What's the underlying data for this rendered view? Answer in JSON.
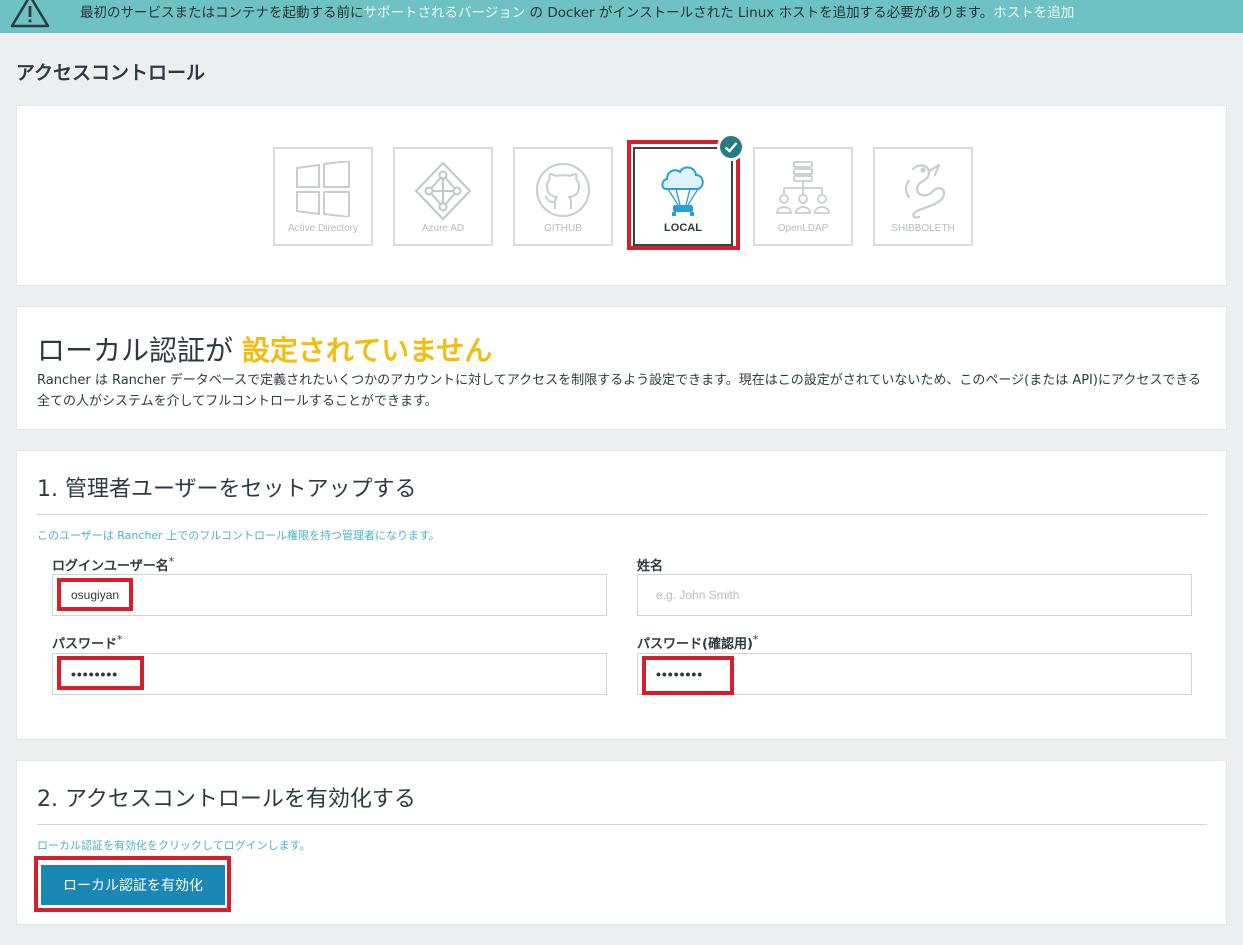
{
  "banner": {
    "icon": "warning-icon",
    "text_before": "最初のサービスまたはコンテナを起動する前に",
    "link_supported": "サポートされるバージョン",
    "text_middle": "の Docker がインストールされた Linux ホストを追加する必要があります。",
    "link_add_host": "ホストを追加"
  },
  "page_title": "アクセスコントロール",
  "providers": [
    {
      "label": "Active Directory",
      "icon": "windows-logo-icon",
      "active": false
    },
    {
      "label": "Azure AD",
      "icon": "azure-ad-icon",
      "active": false
    },
    {
      "label": "GITHUB",
      "icon": "github-icon",
      "active": false
    },
    {
      "label": "LOCAL",
      "icon": "cloud-parachute-icon",
      "active": true
    },
    {
      "label": "OpenLDAP",
      "icon": "ldap-tree-icon",
      "active": false
    },
    {
      "label": "SHIBBOLETH",
      "icon": "shibboleth-dragon-icon",
      "active": false
    }
  ],
  "notice": {
    "title_prefix": "ローカル認証が ",
    "title_state": "設定されていません",
    "body": "Rancher は Rancher データベースで定義されたいくつかのアカウントに対してアクセスを制限するよう設定できます。現在はこの設定がされていないため、このページ(または API)にアクセスできる全ての人がシステムを介してフルコントロールすることができます。"
  },
  "setup": {
    "title": "1. 管理者ユーザーをセットアップする",
    "help": "このユーザーは Rancher 上でのフルコントロール権限を持つ管理者になります。",
    "username_label": "ログインユーザー名",
    "username_value": "osugiyan",
    "fullname_label": "姓名",
    "fullname_placeholder": "e.g. John Smith",
    "password_label": "パスワード",
    "password_value": "••••••••",
    "confirm_label": "パスワード(確認用)",
    "confirm_value": "••••••••",
    "required_mark": "*"
  },
  "enable": {
    "title": "2. アクセスコントロールを有効化する",
    "help": "ローカル認証を有効化をクリックしてログインします。",
    "button_label": "ローカル認証を有効化"
  },
  "colors": {
    "banner_bg": "#6fc2c2",
    "state_warning": "#f0bd10",
    "primary_button": "#1b87b3",
    "highlight_red": "#d5202b",
    "help_text": "#49b5c5",
    "check_badge": "#2a7a84"
  }
}
